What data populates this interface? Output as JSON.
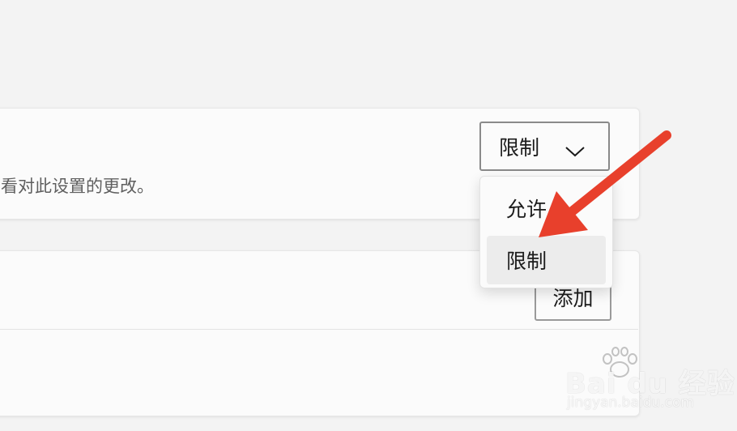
{
  "restriction_card": {
    "description": "看对此设置的更改。",
    "dropdown": {
      "selected": "限制",
      "options": [
        "允许",
        "限制"
      ]
    }
  },
  "list_card": {
    "add_label": "添加"
  },
  "watermark": {
    "logo": "Bai du 经验",
    "url": "jingyan.baidu.com"
  },
  "colors": {
    "annotation_arrow": "#e8402c",
    "selected_option_bg": "#ececec"
  },
  "icons": {
    "dropdown": "chevron-down-icon",
    "annotation": "red-arrow-icon",
    "watermark": "baidu-paw-icon"
  }
}
